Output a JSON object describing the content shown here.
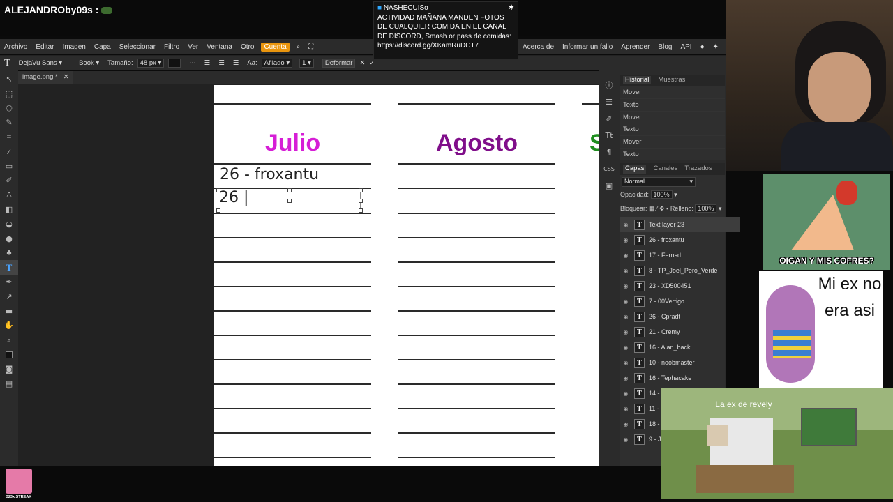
{
  "stream": {
    "streamer_name": "ALEJANDROby09s :",
    "chat_user": "NASHECUISo",
    "chat_message": "ACTIVIDAD MAÑANA MANDEN FOTOS DE CUALQUIER COMIDA EN EL CANAL DE DISCORD, Smash or pass de comidas: https://discord.gg/XKamRuDCT7",
    "streak_label": "323x STREAK"
  },
  "menu": {
    "items": [
      "Archivo",
      "Editar",
      "Imagen",
      "Capa",
      "Seleccionar",
      "Filtro",
      "Ver",
      "Ventana",
      "Otro"
    ],
    "account": "Cuenta",
    "right_items": [
      "Acerca de",
      "Informar un fallo",
      "Aprender",
      "Blog",
      "API"
    ]
  },
  "options": {
    "font": "DejaVu Sans",
    "style": "Book",
    "size_label": "Tamaño:",
    "size_value": "48 px",
    "aa_label": "Aa:",
    "aa_value": "Afilado",
    "line_value": "1",
    "deform_button": "Deformar"
  },
  "document": {
    "tab_name": "image.png *",
    "months": [
      "Julio",
      "Agosto",
      "S"
    ],
    "entry_1": "26 - froxantu",
    "entry_editing": "26 |"
  },
  "history": {
    "tabs": [
      "Historial",
      "Muestras"
    ],
    "entries": [
      "Mover",
      "Texto",
      "Mover",
      "Texto",
      "Mover",
      "Texto"
    ]
  },
  "layers": {
    "tabs": [
      "Capas",
      "Canales",
      "Trazados"
    ],
    "blend_mode": "Normal",
    "opacity_label": "Opacidad:",
    "opacity_value": "100%",
    "lock_label": "Bloquear:",
    "fill_label": "Relleno:",
    "fill_value": "100%",
    "items": [
      "Text layer 23",
      "26 - froxantu",
      "17 - Fernsd",
      "8 - TP_Joel_Pero_Verde",
      "23 - XD500451",
      "7 - 00Vertigo",
      "26 - Cpradt",
      "21 - Cremy",
      "16 - Alan_back",
      "10 - noobmaster",
      "16 - Tephacake",
      "14 - A",
      "11 -",
      "18 -",
      "9 - Je"
    ]
  },
  "memes": {
    "phineas_caption": "OIGAN Y MIS COFRES?",
    "austin_caption": "Mi ex no era asi",
    "sheep_caption": "La ex de revely"
  },
  "colors": {
    "julio": "#d61ed6",
    "agosto": "#800e8a",
    "september": "#1e8e1e",
    "accent": "#e9950e"
  }
}
